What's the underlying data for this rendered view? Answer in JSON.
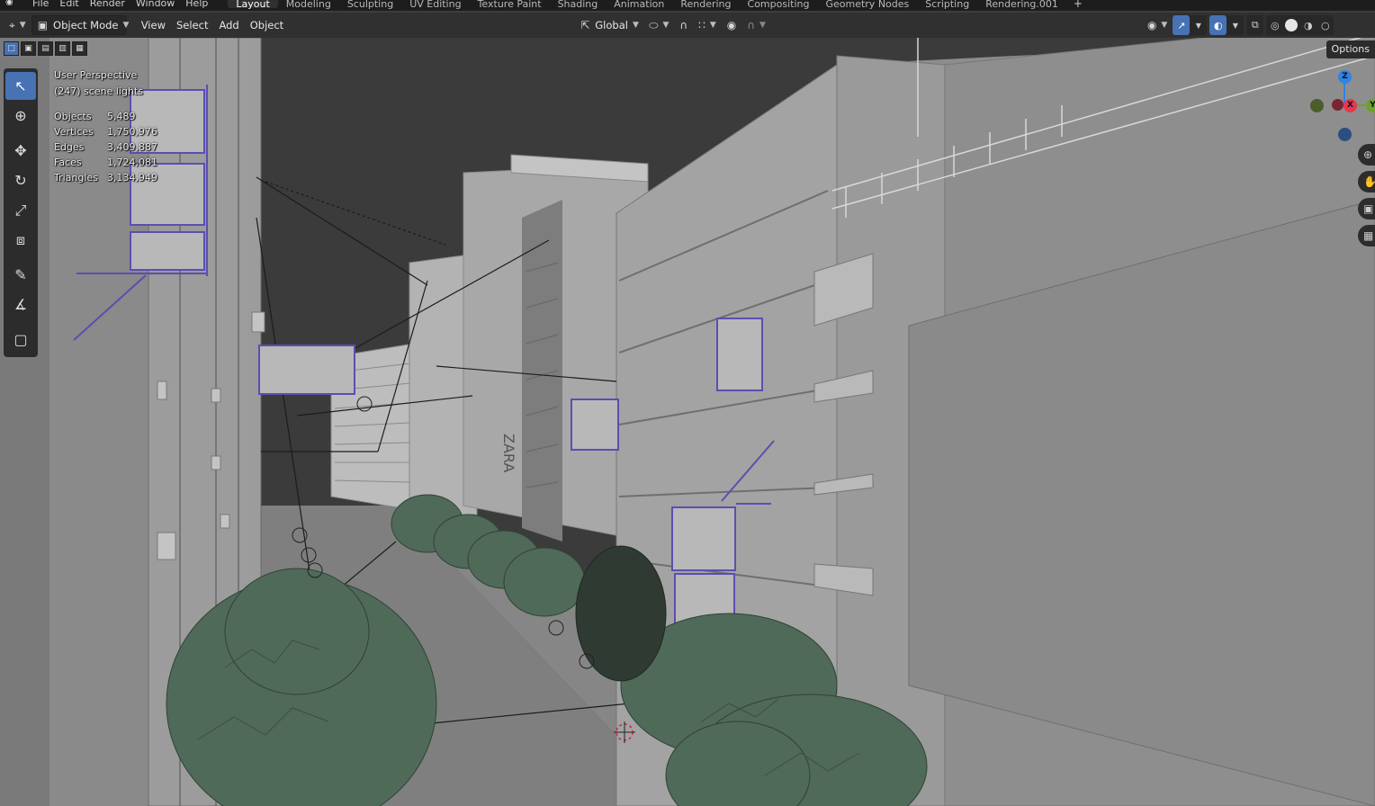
{
  "topbar": {
    "menus": [
      "File",
      "Edit",
      "Render",
      "Window",
      "Help"
    ],
    "workspaces": [
      "Layout",
      "Modeling",
      "Sculpting",
      "UV Editing",
      "Texture Paint",
      "Shading",
      "Animation",
      "Rendering",
      "Compositing",
      "Geometry Nodes",
      "Scripting",
      "Rendering.001"
    ],
    "active_workspace": "Layout",
    "add_tab": "+"
  },
  "header": {
    "mode": "Object Mode",
    "menus": [
      "View",
      "Select",
      "Add",
      "Object"
    ],
    "orientation": "Global"
  },
  "viewport": {
    "perspective": "User Perspective",
    "collection": "(247) scene lights",
    "stats": [
      {
        "label": "Objects",
        "value": "5,489"
      },
      {
        "label": "Vertices",
        "value": "1,750,976"
      },
      {
        "label": "Edges",
        "value": "3,409,887"
      },
      {
        "label": "Faces",
        "value": "1,724,081"
      },
      {
        "label": "Triangles",
        "value": "3,134,949"
      }
    ],
    "options_label": "Options",
    "gizmo": {
      "z": "Z",
      "x": "X",
      "y": "Y"
    },
    "storefront_text": "ZARA"
  },
  "colors": {
    "accent": "#4772b3",
    "selection_outline": "#5a4fb0",
    "axis_x": "#e8364f",
    "axis_y": "#6ba22f",
    "axis_z": "#2f83e3"
  },
  "icons": {
    "tools": [
      "select-box-icon",
      "cursor-icon",
      "move-icon",
      "rotate-icon",
      "scale-icon",
      "transform-icon",
      "annotate-icon",
      "measure-icon",
      "add-cube-icon"
    ]
  }
}
